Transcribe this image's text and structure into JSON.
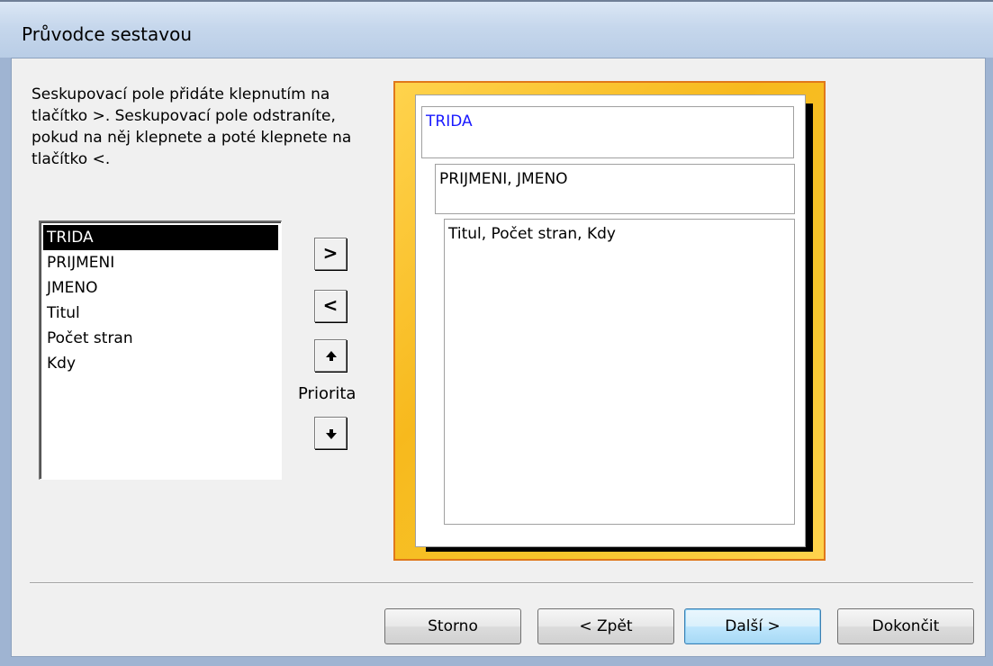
{
  "window": {
    "title": "Průvodce sestavou"
  },
  "instructions": "Seskupovací pole přidáte klepnutím na tlačítko >. Seskupovací pole odstraníte, pokud na něj klepnete a poté klepnete na tlačítko <.",
  "field_list": {
    "items": [
      "TRIDA",
      "PRIJMENI",
      "JMENO",
      "Titul",
      "Počet stran",
      "Kdy"
    ],
    "selected": "TRIDA"
  },
  "buttons_small": {
    "add_label": ">",
    "remove_label": "<",
    "up_icon": "arrow-up-icon",
    "down_icon": "arrow-down-icon",
    "priority_label": "Priorita"
  },
  "preview": {
    "level1": "TRIDA",
    "level2": "PRIJMENI, JMENO",
    "detail": "Titul, Počet stran, Kdy"
  },
  "footer": {
    "cancel_label": "Storno",
    "back_label": "< Zpět",
    "back_accel": "Z",
    "next_label": "Další >",
    "next_accel": "D",
    "finish_label": "Dokončit",
    "finish_accel": "k"
  },
  "colors": {
    "selection_bg": "#000000",
    "group_level_text": "#1a1aff",
    "preview_frame": "#f7b91d",
    "default_button": "#bee6fd"
  }
}
